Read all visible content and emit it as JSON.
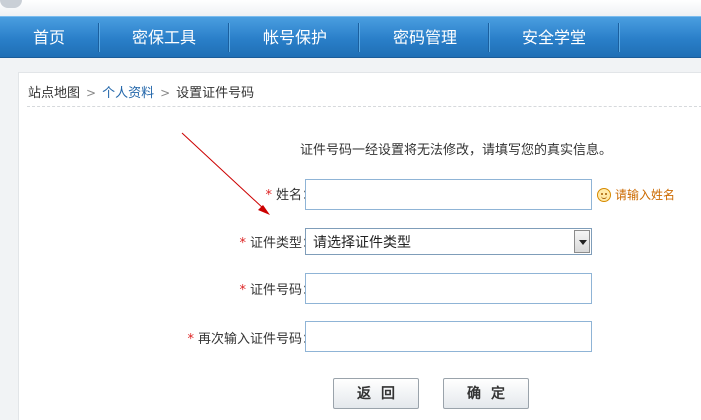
{
  "nav": {
    "items": [
      {
        "label": "首页"
      },
      {
        "label": "密保工具"
      },
      {
        "label": "帐号保护"
      },
      {
        "label": "密码管理"
      },
      {
        "label": "安全学堂"
      }
    ]
  },
  "breadcrumb": {
    "items": [
      "站点地图",
      "个人资料",
      "设置证件号码"
    ],
    "separator": ">"
  },
  "form": {
    "notice": "证件号码一经设置将无法修改，请填写您的真实信息。",
    "required_mark": "*",
    "name_label": "姓名：",
    "name_value": "",
    "name_hint": "请输入姓名",
    "id_type_label": "证件类型：",
    "id_type_selected": "请选择证件类型",
    "id_number_label": "证件号码：",
    "id_number_value": "",
    "id_number_confirm_label": "再次输入证件号码：",
    "id_number_confirm_value": ""
  },
  "buttons": {
    "back_label": "返回",
    "confirm_label": "确定"
  },
  "colors": {
    "nav_bg": "#2a7fc9",
    "required_star": "#dd2222",
    "hint_text": "#cc6a00",
    "annotation_arrow": "#cc0000"
  },
  "icons": {
    "hint": "smiley-icon",
    "select_toggle": "chevron-down-icon",
    "breadcrumb_sep": "chevron-right-icon",
    "annotation": "arrow-icon"
  }
}
